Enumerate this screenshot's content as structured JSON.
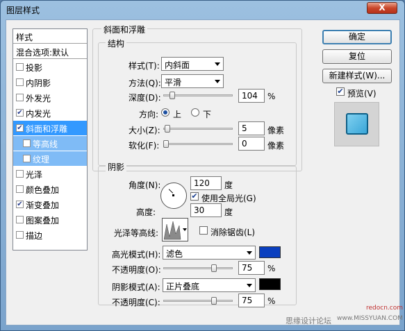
{
  "window": {
    "title": "图层样式",
    "close_glyph": "X"
  },
  "sidebar": {
    "header": "样式",
    "blend_options": "混合选项:默认",
    "items": [
      {
        "label": "投影",
        "checked": false
      },
      {
        "label": "内阴影",
        "checked": false
      },
      {
        "label": "外发光",
        "checked": false
      },
      {
        "label": "内发光",
        "checked": true
      },
      {
        "label": "斜面和浮雕",
        "checked": true,
        "selected": true
      },
      {
        "label": "等高线",
        "checked": false,
        "sub": true
      },
      {
        "label": "纹理",
        "checked": false,
        "sub": true
      },
      {
        "label": "光泽",
        "checked": false
      },
      {
        "label": "颜色叠加",
        "checked": false
      },
      {
        "label": "渐变叠加",
        "checked": true
      },
      {
        "label": "图案叠加",
        "checked": false
      },
      {
        "label": "描边",
        "checked": false
      }
    ]
  },
  "bevel": {
    "section_title": "斜面和浮雕",
    "structure_title": "结构",
    "style_label": "样式(T):",
    "style_value": "内斜面",
    "technique_label": "方法(Q):",
    "technique_value": "平滑",
    "depth_label": "深度(D):",
    "depth_value": "104",
    "depth_unit": "%",
    "depth_level": 0.1,
    "direction_label": "方向:",
    "direction_up": "上",
    "direction_down": "下",
    "size_label": "大小(Z):",
    "size_value": "5",
    "size_unit": "像素",
    "size_level": 0.02,
    "soften_label": "软化(F):",
    "soften_value": "0",
    "soften_unit": "像素",
    "soften_level": 0.0
  },
  "shading": {
    "title": "阴影",
    "angle_label": "角度(N):",
    "angle_value": "120",
    "angle_unit": "度",
    "global_light_label": "使用全局光(G)",
    "global_light_checked": true,
    "altitude_label": "高度:",
    "altitude_value": "30",
    "altitude_unit": "度",
    "gloss_contour_label": "光泽等高线:",
    "antialias_label": "消除锯齿(L)",
    "highlight_mode_label": "高光模式(H):",
    "highlight_mode_value": "滤色",
    "highlight_color": "#0a3fbf",
    "highlight_opacity_label": "不透明度(O):",
    "highlight_opacity_value": "75",
    "highlight_opacity_level": 0.75,
    "shadow_mode_label": "阴影模式(A):",
    "shadow_mode_value": "正片叠底",
    "shadow_color": "#000000",
    "shadow_opacity_label": "不透明度(C):",
    "shadow_opacity_value": "75",
    "shadow_opacity_level": 0.75,
    "percent_unit": "%"
  },
  "buttons": {
    "ok": "确定",
    "reset": "复位",
    "new_style": "新建样式(W)...",
    "preview_label": "预览(V)",
    "preview_checked": true
  },
  "preview_colors": {
    "fill": "#3aa6d8",
    "border": "#0d5f87"
  },
  "watermark": {
    "site": "思缘设计论坛",
    "url": "www.MISSYUAN.COM",
    "brand": "redocn.com"
  }
}
